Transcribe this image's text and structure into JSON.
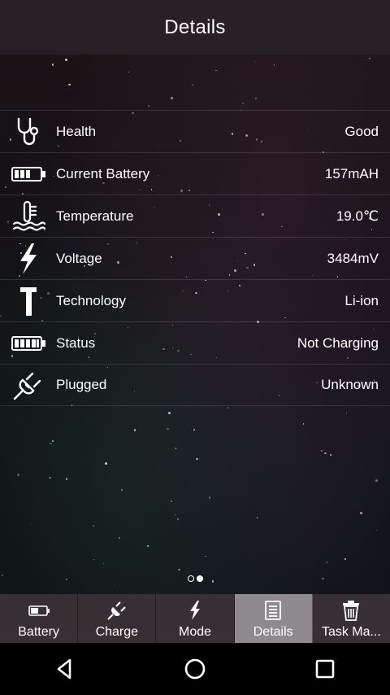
{
  "header": {
    "title": "Details"
  },
  "rows": [
    {
      "icon": "stethoscope-icon",
      "label": "Health",
      "value": "Good"
    },
    {
      "icon": "battery-half-icon",
      "label": "Current Battery",
      "value": "157mAH"
    },
    {
      "icon": "thermometer-icon",
      "label": "Temperature",
      "value": "19.0℃"
    },
    {
      "icon": "lightning-icon",
      "label": "Voltage",
      "value": "3484mV"
    },
    {
      "icon": "hammer-icon",
      "label": "Technology",
      "value": "Li-ion"
    },
    {
      "icon": "battery-full-icon",
      "label": "Status",
      "value": "Not Charging"
    },
    {
      "icon": "plug-icon",
      "label": "Plugged",
      "value": "Unknown"
    }
  ],
  "pager": {
    "current": 2,
    "total": 2
  },
  "tabs": [
    {
      "icon": "battery-icon",
      "label": "Battery",
      "active": false
    },
    {
      "icon": "plug-icon",
      "label": "Charge",
      "active": false
    },
    {
      "icon": "lightning-icon",
      "label": "Mode",
      "active": false
    },
    {
      "icon": "document-icon",
      "label": "Details",
      "active": true
    },
    {
      "icon": "trash-icon",
      "label": "Task Ma...",
      "active": false
    }
  ],
  "colors": {
    "header_bg": "#282228",
    "tab_bar_bg": "#3a3236",
    "tab_active_bg": "#8e8a8e",
    "text": "#ffffff"
  }
}
